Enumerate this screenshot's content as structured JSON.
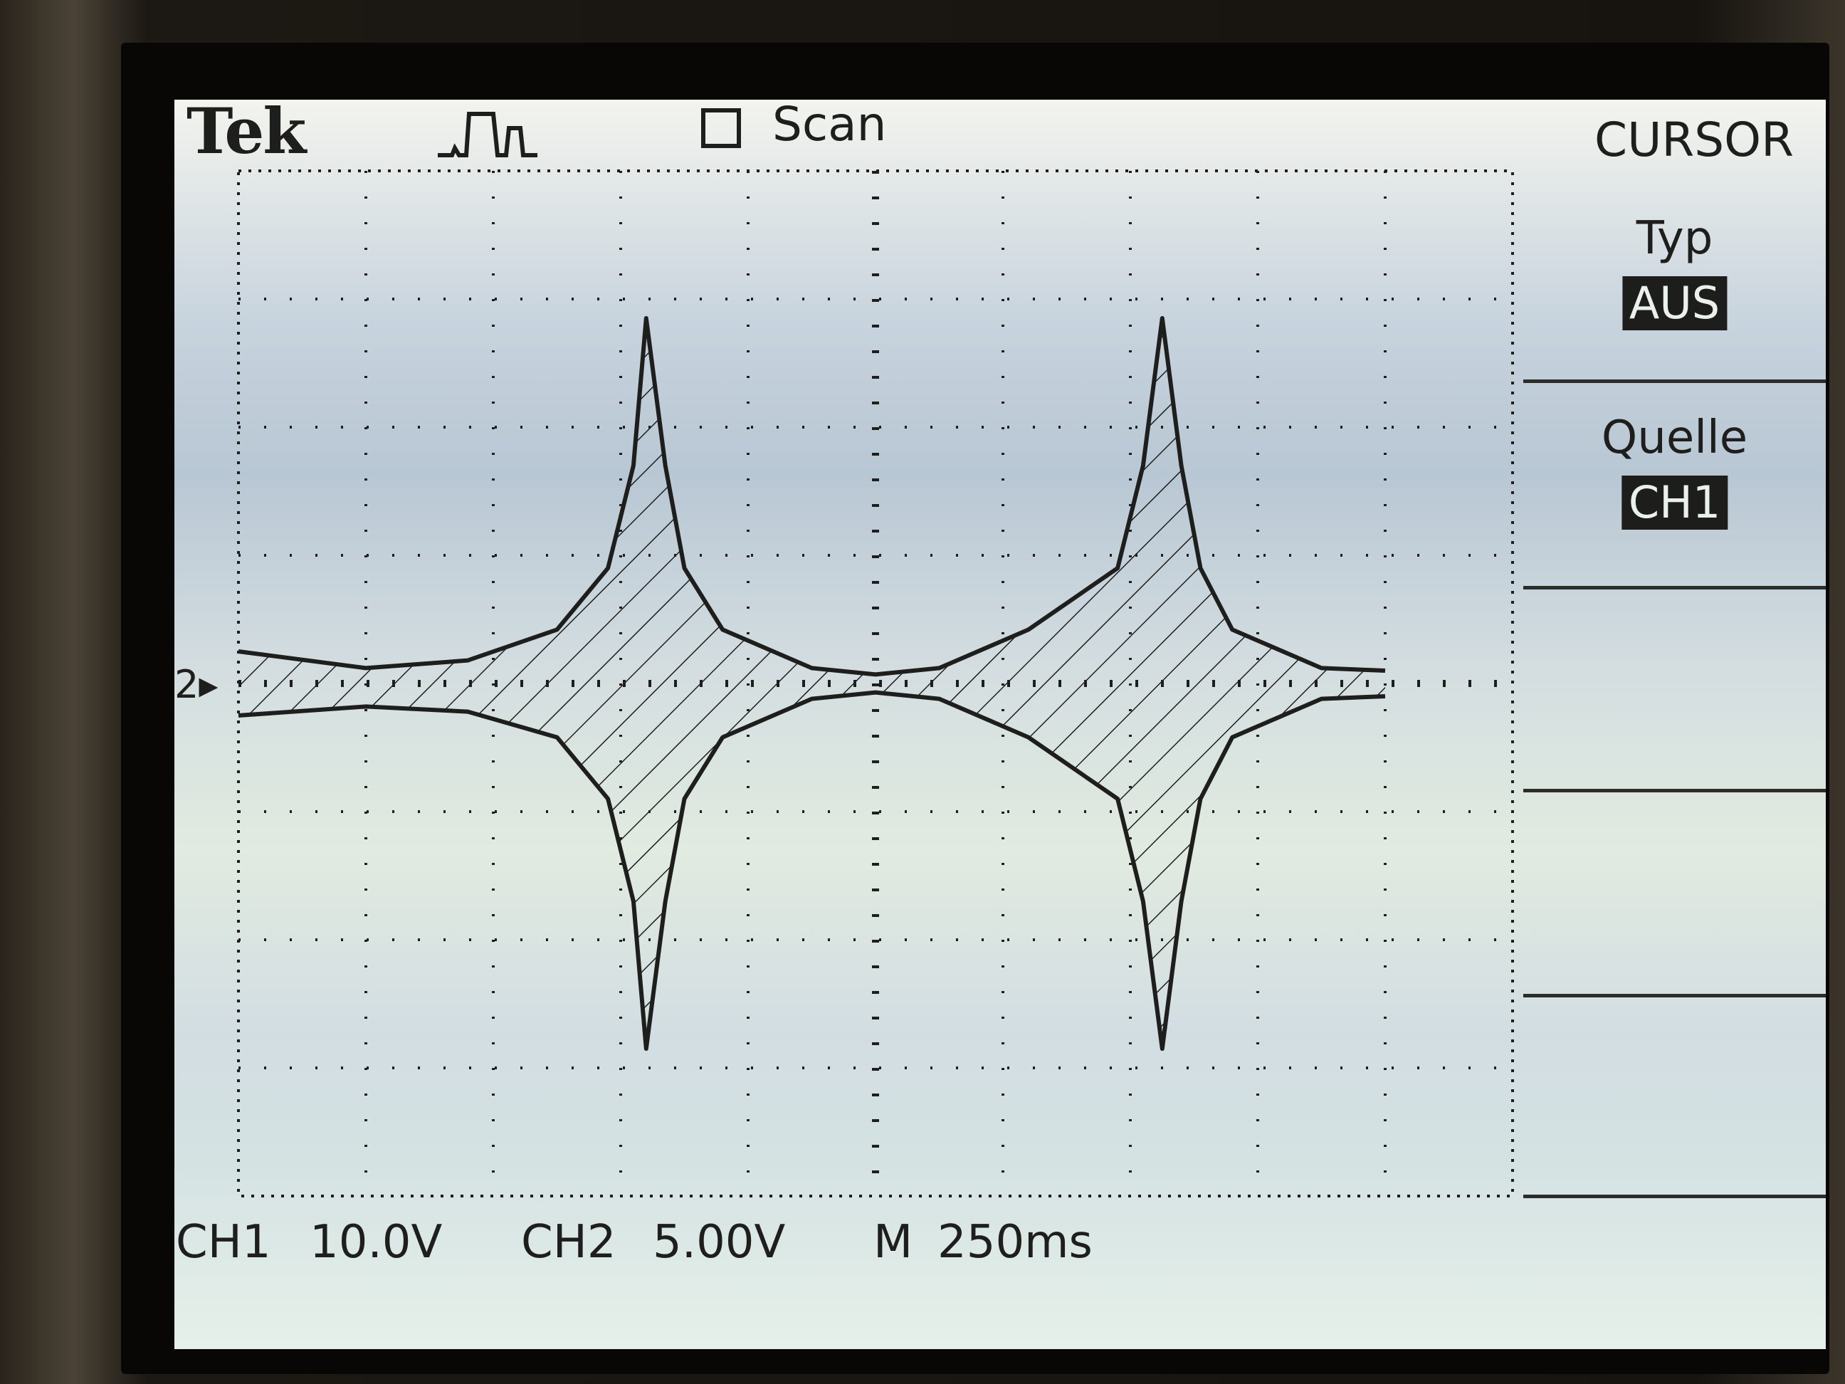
{
  "header": {
    "brand": "Tek",
    "acquisition_icon": "pulse-waveform-icon",
    "scan_checkbox_checked": false,
    "scan_label": "Scan",
    "menu_title": "CURSOR"
  },
  "side_menu": {
    "items": [
      {
        "title": "Typ",
        "value": "AUS"
      },
      {
        "title": "Quelle",
        "value": "CH1"
      },
      {
        "title": "",
        "value": ""
      },
      {
        "title": "",
        "value": ""
      },
      {
        "title": "",
        "value": ""
      }
    ]
  },
  "channel_marker": "2",
  "status": {
    "ch1_label": "CH1",
    "ch1_scale": "10.0V",
    "ch2_label": "CH2",
    "ch2_scale": "5.00V",
    "timebase_label": "M",
    "timebase_value": "250ms"
  },
  "colors": {
    "trace": "#1e1f1c",
    "screen_bg": "#d3dde0",
    "highlight_bg": "#1d1e1b",
    "highlight_text": "#eaf0ea"
  },
  "chart_data": {
    "type": "line",
    "title": "",
    "xlabel": "",
    "ylabel": "",
    "grid": true,
    "xlim": [
      0,
      10
    ],
    "ylim": [
      -4,
      4
    ],
    "series": [
      {
        "name": "",
        "x": [
          0,
          1,
          1.8,
          2.5,
          2.9,
          3.1,
          3.2,
          3.35,
          3.5,
          3.8,
          4.5,
          5,
          5.5,
          6.2,
          6.9,
          7.1,
          7.25,
          7.4,
          7.55,
          7.8,
          8.5,
          9
        ],
        "y": [
          0.25,
          0.12,
          0.18,
          0.42,
          0.9,
          1.7,
          2.85,
          1.7,
          0.9,
          0.42,
          0.12,
          0.07,
          0.12,
          0.42,
          0.9,
          1.7,
          2.85,
          1.7,
          0.9,
          0.42,
          0.12,
          0.1
        ]
      },
      {
        "name": "",
        "x": [
          0,
          1,
          1.8,
          2.5,
          2.9,
          3.1,
          3.2,
          3.35,
          3.5,
          3.8,
          4.5,
          5,
          5.5,
          6.2,
          6.9,
          7.1,
          7.25,
          7.4,
          7.55,
          7.8,
          8.5,
          9
        ],
        "y": [
          -0.25,
          -0.18,
          -0.22,
          -0.42,
          -0.9,
          -1.7,
          -2.85,
          -1.7,
          -0.9,
          -0.42,
          -0.12,
          -0.07,
          -0.12,
          -0.42,
          -0.9,
          -1.7,
          -2.85,
          -1.7,
          -0.9,
          -0.42,
          -0.12,
          -0.1
        ]
      }
    ]
  }
}
